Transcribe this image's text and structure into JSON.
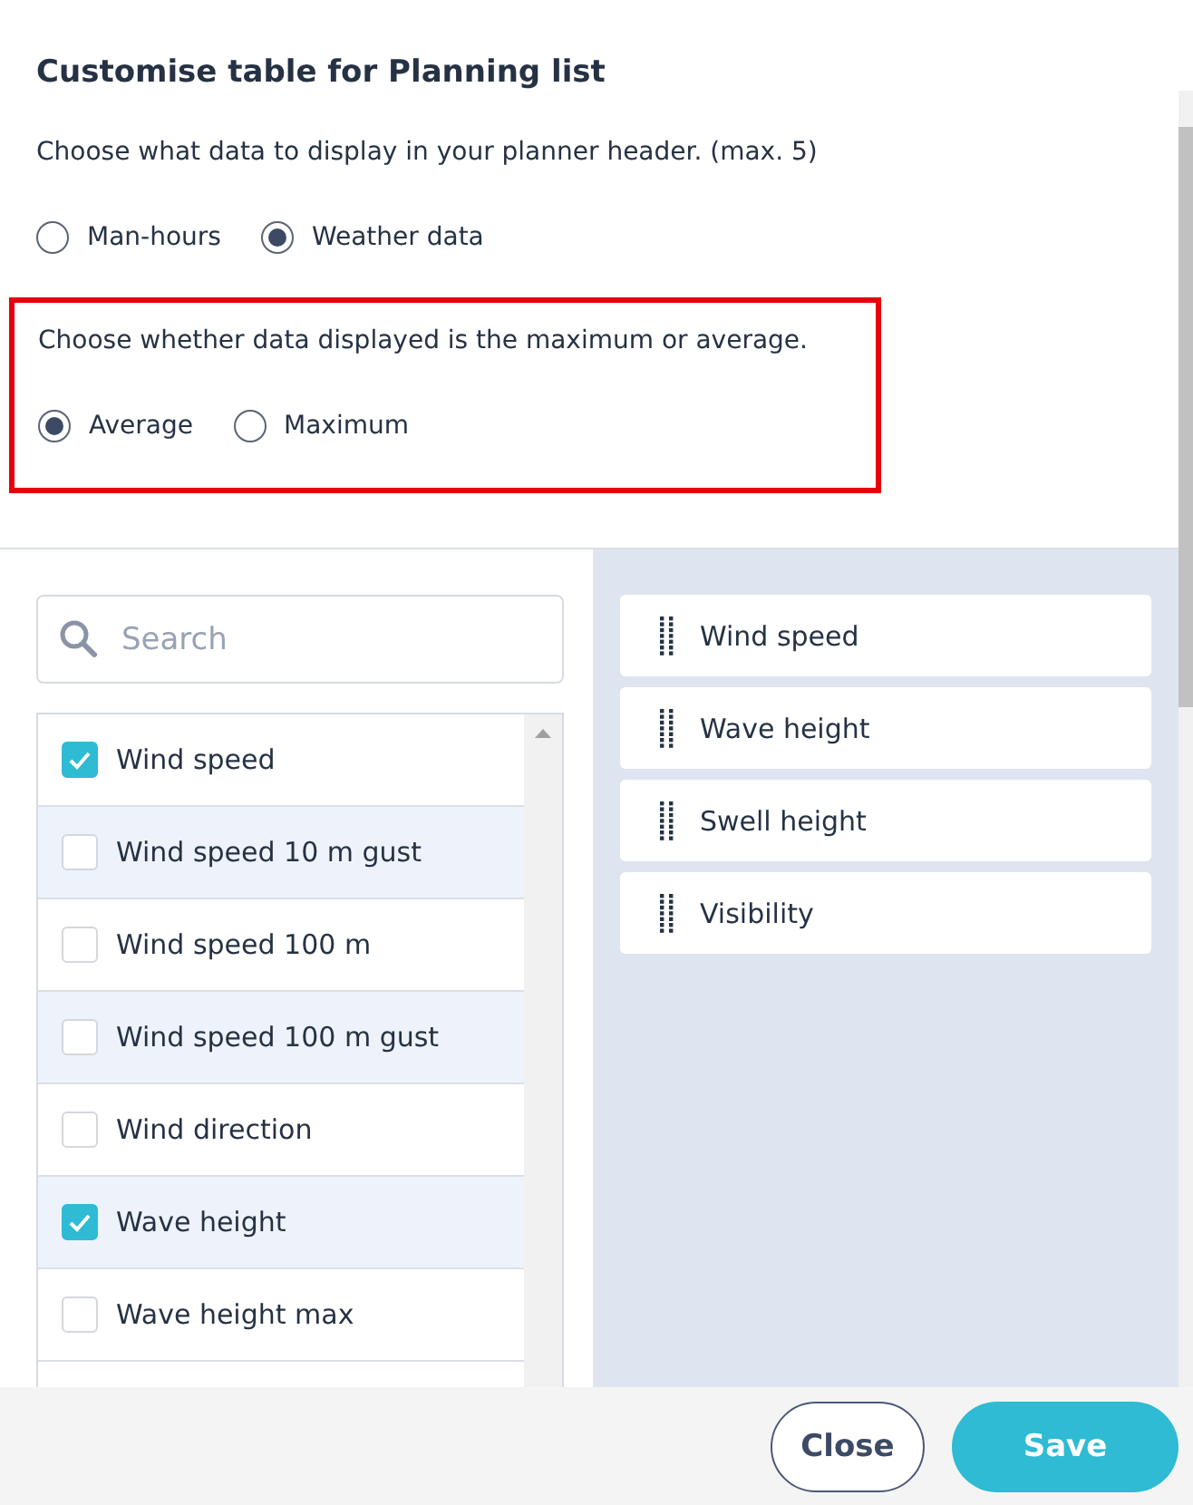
{
  "dialog": {
    "title": "Customise table for Planning list"
  },
  "header_data": {
    "prompt": "Choose what data to display in your planner header. (max. 5)",
    "options": [
      {
        "label": "Man-hours",
        "selected": false
      },
      {
        "label": "Weather data",
        "selected": true
      }
    ]
  },
  "aggregation": {
    "highlighted": true,
    "prompt": "Choose whether data displayed is the maximum or average.",
    "options": [
      {
        "label": "Average",
        "selected": true
      },
      {
        "label": "Maximum",
        "selected": false
      }
    ]
  },
  "search": {
    "placeholder": "Search"
  },
  "available": [
    {
      "label": "Wind speed",
      "checked": true
    },
    {
      "label": "Wind speed 10 m gust",
      "checked": false
    },
    {
      "label": "Wind speed 100 m",
      "checked": false
    },
    {
      "label": "Wind speed 100 m gust",
      "checked": false
    },
    {
      "label": "Wind direction",
      "checked": false
    },
    {
      "label": "Wave height",
      "checked": true
    },
    {
      "label": "Wave height max",
      "checked": false
    }
  ],
  "selected_columns": [
    "Wind speed",
    "Wave height",
    "Swell height",
    "Visibility"
  ],
  "buttons": [
    {
      "label": "Close",
      "kind": "secondary"
    },
    {
      "label": "Save",
      "kind": "primary"
    }
  ]
}
